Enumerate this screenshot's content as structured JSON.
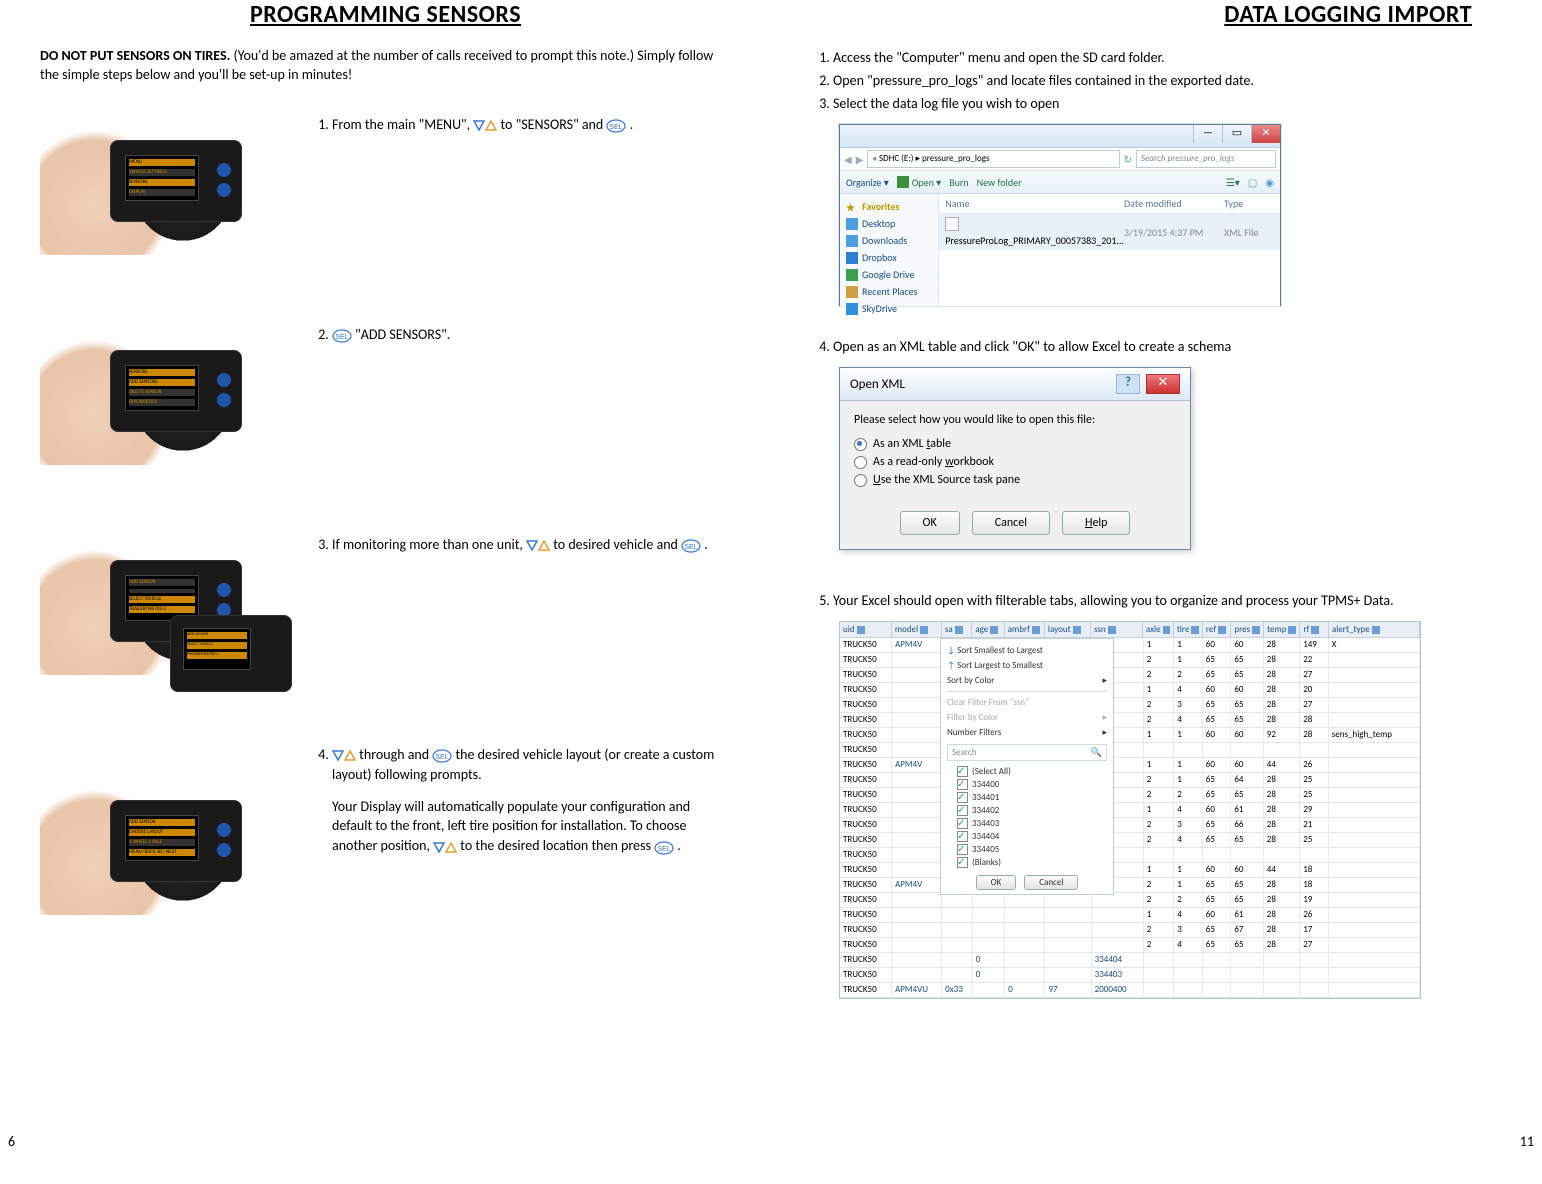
{
  "left": {
    "heading": "PROGRAMMING SENSORS",
    "intro_bold": "DO NOT PUT SENSORS ON TIRES.",
    "intro_rest": " (You'd be amazed at the number of calls received to prompt this note.) Simply follow the simple steps below and you'll be set-up in minutes!",
    "step1_a": "From the main \"MENU\", ",
    "step1_b": " to \"SENSORS\" and ",
    "step1_c": " .",
    "step2_a": "",
    "step2_b": " \"ADD SENSORS\".",
    "step3_a": "If monitoring more than one unit, ",
    "step3_b": " to desired vehicle and ",
    "step3_c": " .",
    "step4_a": "",
    "step4_b": " through and ",
    "step4_c": " the desired vehicle layout (or create a custom layout) following prompts.",
    "step4_p2a": "Your Display will automatically populate your configuration and default to the front, left tire position for installation. To choose another position, ",
    "step4_p2b": " to the desired location then press ",
    "step4_p2c": " .",
    "page_number": "6",
    "device_menu": {
      "s1": [
        "MENU",
        "VEHICLE SETTINGS",
        "SENSORS",
        "DISPLAY"
      ],
      "s2": [
        "SENSORS",
        "ADD SENSORS",
        "DELETE SENSOR",
        "DIAGNOSTICS"
      ],
      "s3": [
        "ADD SENSOR",
        "SELECT VEHICLE",
        "TRAILER/WS702-2"
      ],
      "s4": [
        "ADD SENSOR",
        "CHOOSE LAYOUT",
        "1 WHEEL 1 AXLE",
        "MENU=BACK  SEL=NEXT"
      ]
    }
  },
  "right": {
    "heading": "DATA LOGGING IMPORT",
    "top_steps": [
      "Access the \"Computer\" menu and open the SD card folder.",
      "Open \"pressure_pro_logs\" and locate files contained in the exported date.",
      "Select the data log file you wish to open"
    ],
    "step4": "Open as an XML table and click \"OK\" to allow Excel to create a schema",
    "step5": "Your Excel should open with filterable tabs, allowing you to organize and process your TPMS+ Data.",
    "page_number": "11",
    "explorer": {
      "path": "« SDHC (E:) ▸ pressure_pro_logs",
      "search_placeholder": "Search pressure_pro_logs",
      "organize": "Organize ▾",
      "open": "Open ▾",
      "burn": "Burn",
      "newfolder": "New folder",
      "favorites": "Favorites",
      "nav": [
        "Desktop",
        "Downloads",
        "Dropbox",
        "Google Drive",
        "Recent Places",
        "SkyDrive"
      ],
      "col_name": "Name",
      "col_date": "Date modified",
      "col_type": "Type",
      "file_name": "PressureProLog_PRIMARY_00057383_201...",
      "file_date": "3/19/2015 4:37 PM",
      "file_type": "XML File"
    },
    "xml_dialog": {
      "title": "Open XML",
      "prompt": "Please select how you would like to open this file:",
      "opt1": "As an XML table",
      "opt2": "As a read-only workbook",
      "opt3": "Use the XML Source task pane",
      "ok": "OK",
      "cancel": "Cancel",
      "help": "Help"
    },
    "excel": {
      "headers": [
        "uid",
        "model",
        "sa",
        "age",
        "ambrf",
        "layout",
        "ssn",
        "axle",
        "tire",
        "ref",
        "pres",
        "temp",
        "rf",
        "alert_type"
      ],
      "filter": {
        "sort_asc": "Sort Smallest to Largest",
        "sort_desc": "Sort Largest to Smallest",
        "sort_color": "Sort by Color",
        "clear": "Clear Filter From \"ssn\"",
        "filter_color": "Filter by Color",
        "num_filters": "Number Filters",
        "search": "Search",
        "items": [
          "(Select All)",
          "334400",
          "334401",
          "334402",
          "334403",
          "334404",
          "334405",
          "(Blanks)"
        ],
        "ok": "OK",
        "cancel": "Cancel"
      },
      "rows_left": [
        [
          "TRUCK50",
          "APM4V"
        ],
        [
          "TRUCK50",
          ""
        ],
        [
          "TRUCK50",
          ""
        ],
        [
          "TRUCK50",
          ""
        ],
        [
          "TRUCK50",
          ""
        ],
        [
          "TRUCK50",
          ""
        ],
        [
          "TRUCK50",
          ""
        ],
        [
          "TRUCK50",
          ""
        ],
        [
          "TRUCK50",
          "APM4V"
        ],
        [
          "TRUCK50",
          ""
        ],
        [
          "TRUCK50",
          ""
        ],
        [
          "TRUCK50",
          ""
        ],
        [
          "TRUCK50",
          ""
        ],
        [
          "TRUCK50",
          ""
        ],
        [
          "TRUCK50",
          ""
        ],
        [
          "TRUCK50",
          ""
        ],
        [
          "TRUCK50",
          "APM4V"
        ],
        [
          "TRUCK50",
          ""
        ],
        [
          "TRUCK50",
          ""
        ],
        [
          "TRUCK50",
          ""
        ],
        [
          "TRUCK50",
          ""
        ],
        [
          "TRUCK50",
          "",
          "",
          "0",
          "",
          "",
          "334404"
        ],
        [
          "TRUCK50",
          "",
          "",
          "0",
          "",
          "",
          "334403"
        ],
        [
          "TRUCK50",
          "APM4VU",
          "0x33",
          "",
          "0",
          "97",
          "2000400"
        ]
      ],
      "rows_right": [
        [
          "1",
          "1",
          "60",
          "60",
          "28",
          "149",
          "X"
        ],
        [
          "2",
          "1",
          "65",
          "65",
          "28",
          "22",
          ""
        ],
        [
          "2",
          "2",
          "65",
          "65",
          "28",
          "27",
          ""
        ],
        [
          "1",
          "4",
          "60",
          "60",
          "28",
          "20",
          ""
        ],
        [
          "2",
          "3",
          "65",
          "65",
          "28",
          "27",
          ""
        ],
        [
          "2",
          "4",
          "65",
          "65",
          "28",
          "28",
          ""
        ],
        [
          "1",
          "1",
          "60",
          "60",
          "92",
          "28",
          "sens_high_temp"
        ],
        [
          "",
          "",
          "",
          "",
          "",
          "",
          ""
        ],
        [
          "1",
          "1",
          "60",
          "60",
          "44",
          "26",
          ""
        ],
        [
          "2",
          "1",
          "65",
          "64",
          "28",
          "25",
          ""
        ],
        [
          "2",
          "2",
          "65",
          "65",
          "28",
          "25",
          ""
        ],
        [
          "1",
          "4",
          "60",
          "61",
          "28",
          "29",
          ""
        ],
        [
          "2",
          "3",
          "65",
          "66",
          "28",
          "21",
          ""
        ],
        [
          "2",
          "4",
          "65",
          "65",
          "28",
          "25",
          ""
        ],
        [
          "",
          "",
          "",
          "",
          "",
          "",
          ""
        ],
        [
          "1",
          "1",
          "60",
          "60",
          "44",
          "18",
          ""
        ],
        [
          "2",
          "1",
          "65",
          "65",
          "28",
          "18",
          ""
        ],
        [
          "2",
          "2",
          "65",
          "65",
          "28",
          "19",
          ""
        ],
        [
          "1",
          "4",
          "60",
          "61",
          "28",
          "26",
          ""
        ],
        [
          "2",
          "3",
          "65",
          "67",
          "28",
          "17",
          ""
        ],
        [
          "2",
          "4",
          "65",
          "65",
          "28",
          "27",
          ""
        ],
        [
          "",
          "",
          "",
          "",
          "",
          "",
          ""
        ]
      ]
    }
  }
}
